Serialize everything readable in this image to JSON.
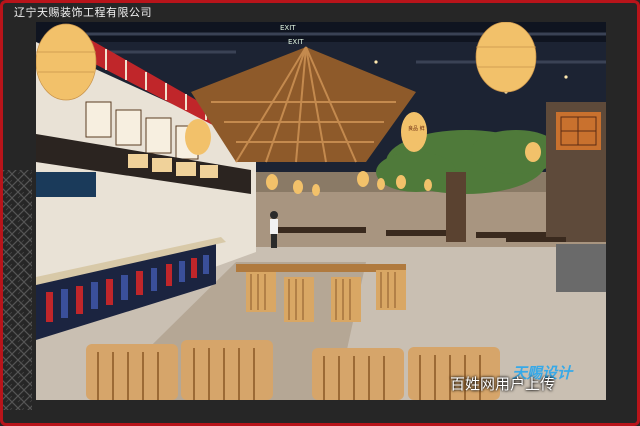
{
  "header": {
    "company_name": "辽宁天赐装饰工程有限公司"
  },
  "photo": {
    "signs": {
      "exit_sign_top": "EXIT",
      "exit_sign_bottom": "EXIT"
    },
    "lantern_text": "良品 鲜"
  },
  "designer_logo": {
    "text": "天赐设计"
  },
  "watermark": {
    "text": "百姓网用户上传"
  },
  "colors": {
    "frame": "#262626",
    "border": "#b8141a",
    "wood": "#b07a3e",
    "lantern": "#f2c16a",
    "tree": "#4f7a3a",
    "floor": "#c9bfb2"
  }
}
